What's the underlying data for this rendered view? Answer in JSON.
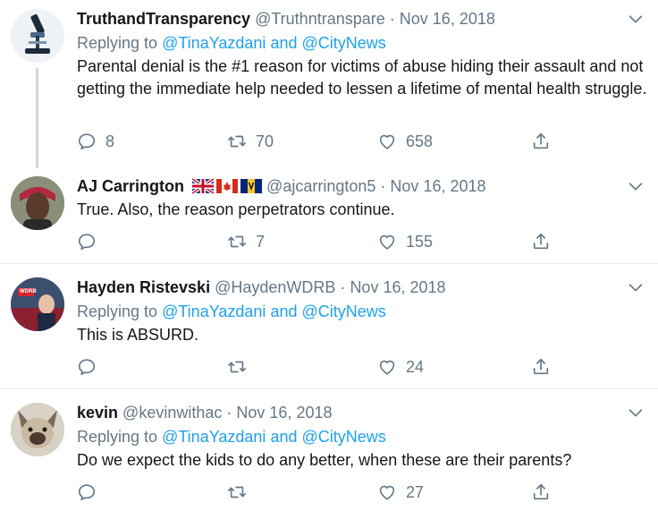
{
  "colors": {
    "link": "#1da1f2",
    "muted": "#657786",
    "text": "#14171a",
    "divider": "#e6ecf0"
  },
  "tweets": [
    {
      "name": "TruthandTransparency",
      "handle": "@Truthntranspare",
      "sep": "·",
      "date": "Nov 16, 2018",
      "replying_prefix": "Replying to",
      "replying_user1": "@TinaYazdani",
      "replying_and": "and",
      "replying_user2": "@CityNews",
      "text": "Parental denial is the #1 reason for victims of abuse hiding their assault and not getting the immediate help needed to lessen a lifetime of mental health struggle.",
      "replies": "8",
      "retweets": "70",
      "likes": "658"
    },
    {
      "name": "AJ Carrington",
      "handle": "@ajcarrington5",
      "sep": "·",
      "date": "Nov 16, 2018",
      "text": "True. Also, the reason perpetrators continue.",
      "replies": "",
      "retweets": "7",
      "likes": "155"
    },
    {
      "name": "Hayden Ristevski",
      "handle": "@HaydenWDRB",
      "sep": "·",
      "date": "Nov 16, 2018",
      "replying_prefix": "Replying to",
      "replying_user1": "@TinaYazdani",
      "replying_and": "and",
      "replying_user2": "@CityNews",
      "text": "This is ABSURD.",
      "replies": "",
      "retweets": "",
      "likes": "24",
      "avatar_logo": "WDRB"
    },
    {
      "name": "kevin",
      "handle": "@kevinwithac",
      "sep": "·",
      "date": "Nov 16, 2018",
      "replying_prefix": "Replying to",
      "replying_user1": "@TinaYazdani",
      "replying_and": "and",
      "replying_user2": "@CityNews",
      "text": "Do we expect the kids to do any better, when these are their parents?",
      "replies": "",
      "retweets": "",
      "likes": "27"
    }
  ],
  "icons": [
    "reply-icon",
    "retweet-icon",
    "like-icon",
    "share-icon",
    "chevron-down-icon"
  ]
}
